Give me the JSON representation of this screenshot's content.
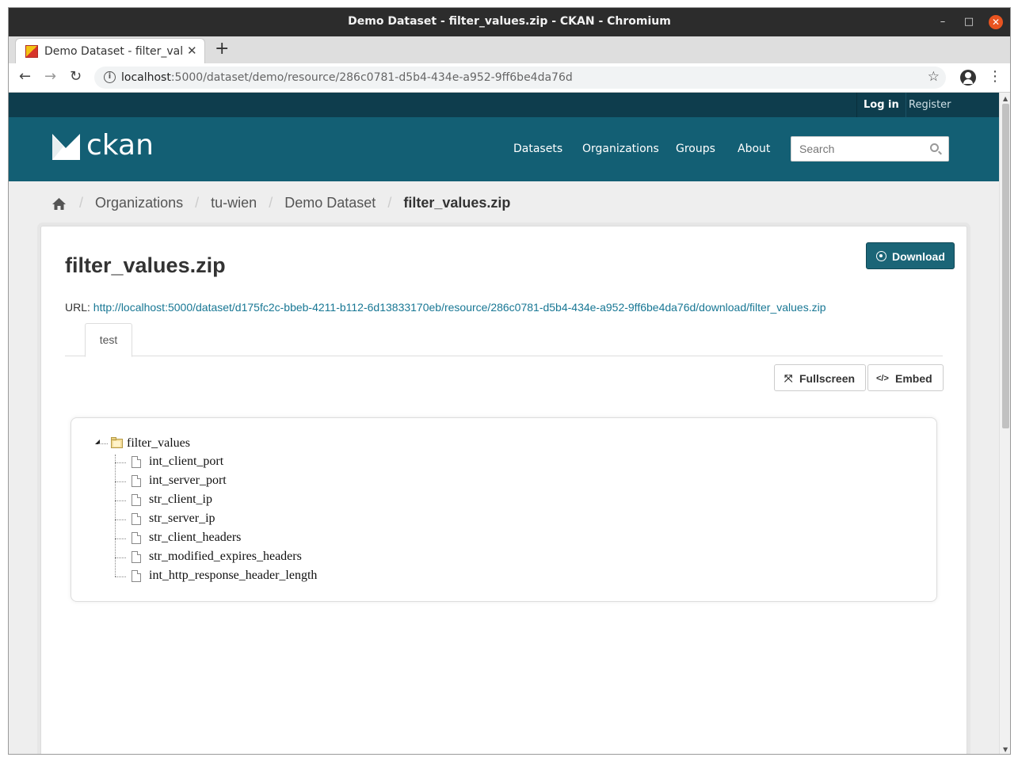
{
  "window": {
    "title": "Demo Dataset - filter_values.zip - CKAN - Chromium",
    "min_glyph": "–",
    "max_glyph": "□",
    "close_glyph": "✕"
  },
  "tab": {
    "title": "Demo Dataset - filter_values.zip",
    "close_glyph": "✕",
    "new_tab_glyph": "+"
  },
  "toolbar": {
    "back_glyph": "←",
    "forward_glyph": "→",
    "reload_glyph": "↻",
    "info_glyph": "i",
    "url_host": "localhost",
    "url_path": ":5000/dataset/demo/resource/286c0781-d5b4-434e-a952-9ff6be4da76d",
    "star_glyph": "☆",
    "menu_glyph": "⋮"
  },
  "account": {
    "login": "Log in",
    "register": "Register"
  },
  "masthead": {
    "logo_text": "ckan",
    "nav": [
      "Datasets",
      "Organizations",
      "Groups",
      "About"
    ],
    "search_placeholder": "Search"
  },
  "breadcrumb": {
    "items": [
      "Organizations",
      "tu-wien",
      "Demo Dataset"
    ],
    "active": "filter_values.zip",
    "sep": "/"
  },
  "resource": {
    "title": "filter_values.zip",
    "download_label": "Download",
    "url_label": "URL:",
    "url": "http://localhost:5000/dataset/d175fc2c-bbeb-4211-b112-6d13833170eb/resource/286c0781-d5b4-434e-a952-9ff6be4da76d/download/filter_values.zip",
    "view_tab": "test",
    "fullscreen_label": "Fullscreen",
    "fullscreen_glyph": "⤧",
    "embed_label": "Embed",
    "embed_glyph": "</>"
  },
  "tree": {
    "root": "filter_values",
    "children": [
      "int_client_port",
      "int_server_port",
      "str_client_ip",
      "str_server_ip",
      "str_client_headers",
      "str_modified_expires_headers",
      "int_http_response_header_length"
    ]
  },
  "colors": {
    "masthead": "#135f74",
    "account_bar": "#0e3d4d",
    "primary_button": "#1b6577",
    "link": "#187794"
  }
}
